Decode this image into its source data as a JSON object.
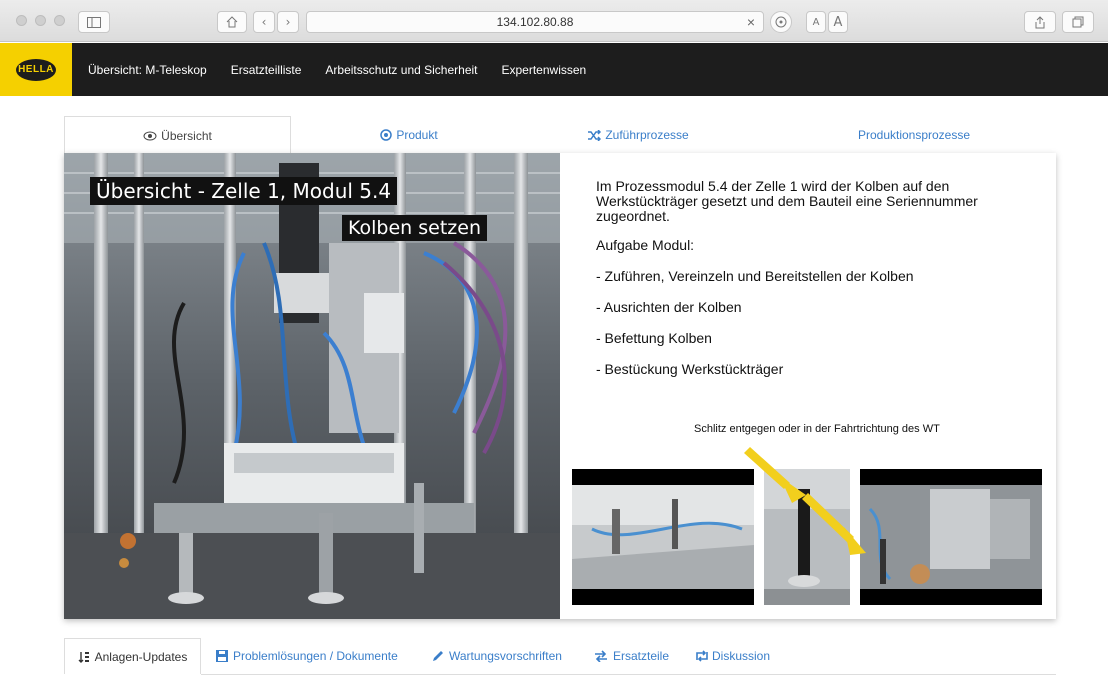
{
  "browser": {
    "url": "134.102.80.88",
    "zoom_small": "A",
    "zoom_large": "A"
  },
  "nav": {
    "logo_text": "HELLA",
    "items": [
      {
        "label": "Übersicht: M-Teleskop"
      },
      {
        "label": "Ersatzteilliste"
      },
      {
        "label": "Arbeitsschutz und Sicherheit"
      },
      {
        "label": "Expertenwissen"
      }
    ]
  },
  "tabs": [
    {
      "label": "Übersicht",
      "icon": "eye-icon"
    },
    {
      "label": "Produkt",
      "icon": "target-icon"
    },
    {
      "label": "Zuführprozesse",
      "icon": "shuffle-icon"
    },
    {
      "label": "Produktionsprozesse",
      "icon": ""
    }
  ],
  "image": {
    "overlay_title": "Übersicht - Zelle 1, Modul 5.4",
    "overlay_sub": "Kolben setzen"
  },
  "description": {
    "intro": "Im Prozessmodul 5.4 der Zelle 1 wird der Kolben auf den Werkstückträger gesetzt und dem Bauteil eine Seriennummer zugeordnet.",
    "task_title": "Aufgabe Modul:",
    "tasks": [
      "- Zuführen, Vereinzeln und Bereitstellen der Kolben",
      "- Ausrichten der Kolben",
      "- Befettung Kolben",
      "- Bestückung Werkstückträger"
    ],
    "slot_note": "Schlitz entgegen oder in der Fahrtrichtung des WT"
  },
  "bottom_tabs": [
    {
      "label": "Anlagen-Updates",
      "icon": "sort-icon"
    },
    {
      "label": "Problemlösungen / Dokumente",
      "icon": "save-icon"
    },
    {
      "label": "Wartungsvorschriften",
      "icon": "pencil-icon"
    },
    {
      "label": "Ersatzteile",
      "icon": "exchange-icon"
    },
    {
      "label": "Diskussion",
      "icon": "retweet-icon"
    }
  ],
  "colors": {
    "brand_yellow": "#f5d000",
    "nav_bg": "#1d1d1d",
    "link_blue": "#3a7ec9",
    "arrow_yellow": "#f2cf1d"
  }
}
